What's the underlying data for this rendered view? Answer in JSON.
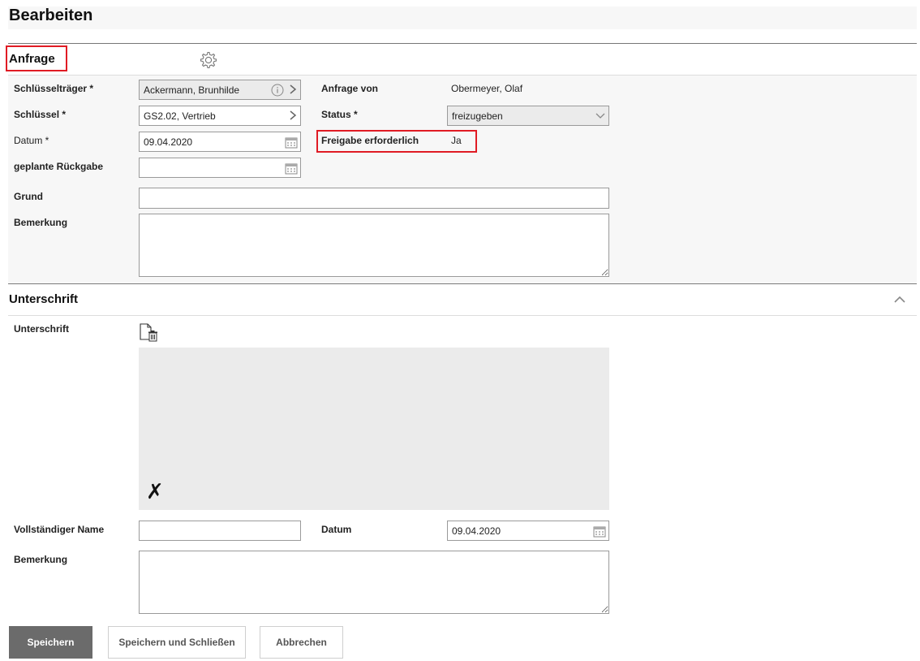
{
  "page": {
    "title": "Bearbeiten"
  },
  "anfrage": {
    "section_title": "Anfrage",
    "settings_icon": "gear-icon",
    "schluesseltraeger_label": "Schlüsselträger *",
    "schluesseltraeger_value": "Ackermann, Brunhilde",
    "schluessel_label": "Schlüssel *",
    "schluessel_value": "GS2.02, Vertrieb",
    "datum_label": "Datum *",
    "datum_value": "09.04.2020",
    "rueckgabe_label": "geplante Rückgabe",
    "rueckgabe_value": "",
    "anfrage_von_label": "Anfrage von",
    "anfrage_von_value": "Obermeyer, Olaf",
    "status_label": "Status *",
    "status_value": "freizugeben",
    "freigabe_label": "Freigabe erforderlich",
    "freigabe_value": "Ja",
    "grund_label": "Grund",
    "grund_value": "",
    "bemerkung_label": "Bemerkung",
    "bemerkung_value": ""
  },
  "unterschrift": {
    "section_title": "Unterschrift",
    "signature_label": "Unterschrift",
    "signature_mark": "✗",
    "name_label": "Vollständiger Name",
    "name_value": "",
    "datum_label": "Datum",
    "datum_value": "09.04.2020",
    "bemerkung_label": "Bemerkung",
    "bemerkung_value": ""
  },
  "actions": {
    "save": "Speichern",
    "save_close": "Speichern und Schließen",
    "cancel": "Abbrechen"
  },
  "colors": {
    "highlight": "#e01b24",
    "primary_button": "#6b6b6b",
    "section_bg": "#f7f7f7"
  }
}
